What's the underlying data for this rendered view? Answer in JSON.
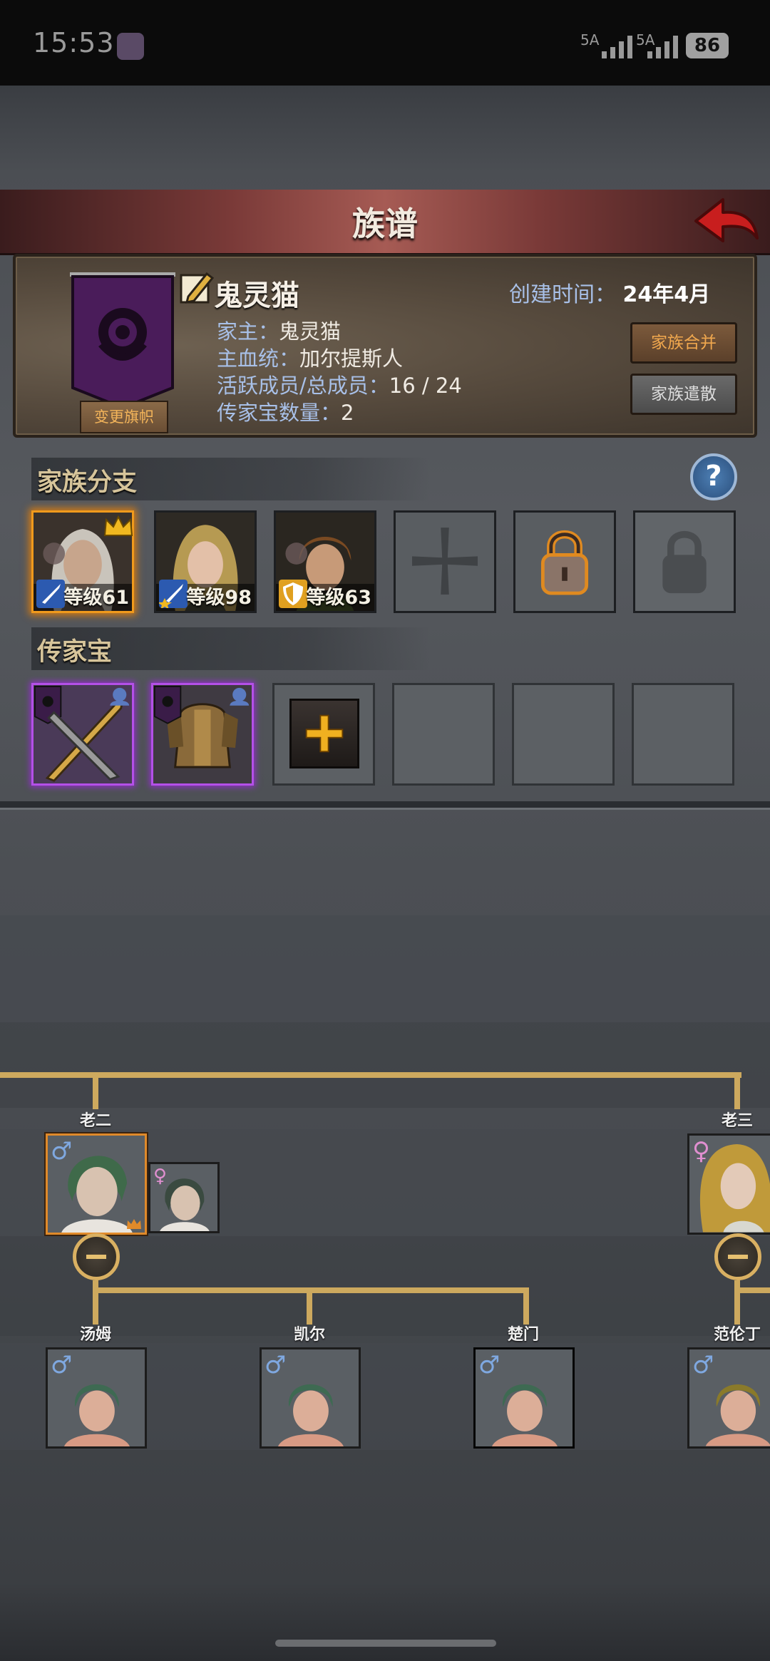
{
  "status_bar": {
    "time": "15:53",
    "sim1": "5A",
    "sim2": "5A",
    "battery": "86"
  },
  "header": {
    "title": "族谱"
  },
  "family": {
    "name": "鬼灵猫",
    "created_label": "创建时间：",
    "created_value": "24年4月",
    "head_label": "家主：",
    "head_value": "鬼灵猫",
    "bloodline_label": "主血统：",
    "bloodline_value": "加尔提斯人",
    "members_label": "活跃成员/总成员：",
    "members_value": "16 / 24",
    "heirloom_count_label": "传家宝数量：",
    "heirloom_count_value": "2",
    "change_flag_label": "变更旗帜",
    "merge_label": "家族合并",
    "disband_label": "家族遣散"
  },
  "branches": {
    "title": "家族分支",
    "help": "?",
    "slots": [
      {
        "level_text": "等级61",
        "state": "leader",
        "class_icon": "sword-icon"
      },
      {
        "level_text": "等级98",
        "state": "member",
        "class_icon": "sword-star-icon"
      },
      {
        "level_text": "等级63",
        "state": "member",
        "class_icon": "shield-icon"
      },
      {
        "state": "empty",
        "icon": "cross-icon"
      },
      {
        "state": "unlockable",
        "icon": "padlock-gold-icon"
      },
      {
        "state": "locked",
        "icon": "padlock-grey-icon"
      }
    ]
  },
  "heirlooms": {
    "title": "传家宝",
    "items": [
      {
        "name_icon": "crossed-weapons-icon",
        "rarity_color": "#b450e8"
      },
      {
        "name_icon": "armor-icon",
        "rarity_color": "#b450e8"
      }
    ],
    "add_icon": "plus-icon"
  },
  "tree": {
    "parents": [
      {
        "name": "老二",
        "gender": "♂"
      },
      {
        "name": "老三",
        "gender": "♀"
      }
    ],
    "spouse_gender": "♀",
    "children": [
      {
        "name": "汤姆",
        "gender": "♂"
      },
      {
        "name": "凯尔",
        "gender": "♂"
      },
      {
        "name": "楚门",
        "gender": "♂"
      },
      {
        "name": "范伦丁",
        "gender": "♂"
      }
    ],
    "colors": {
      "line": "#cda95e",
      "male": "#7fa8e0",
      "female": "#e08fd0"
    }
  }
}
